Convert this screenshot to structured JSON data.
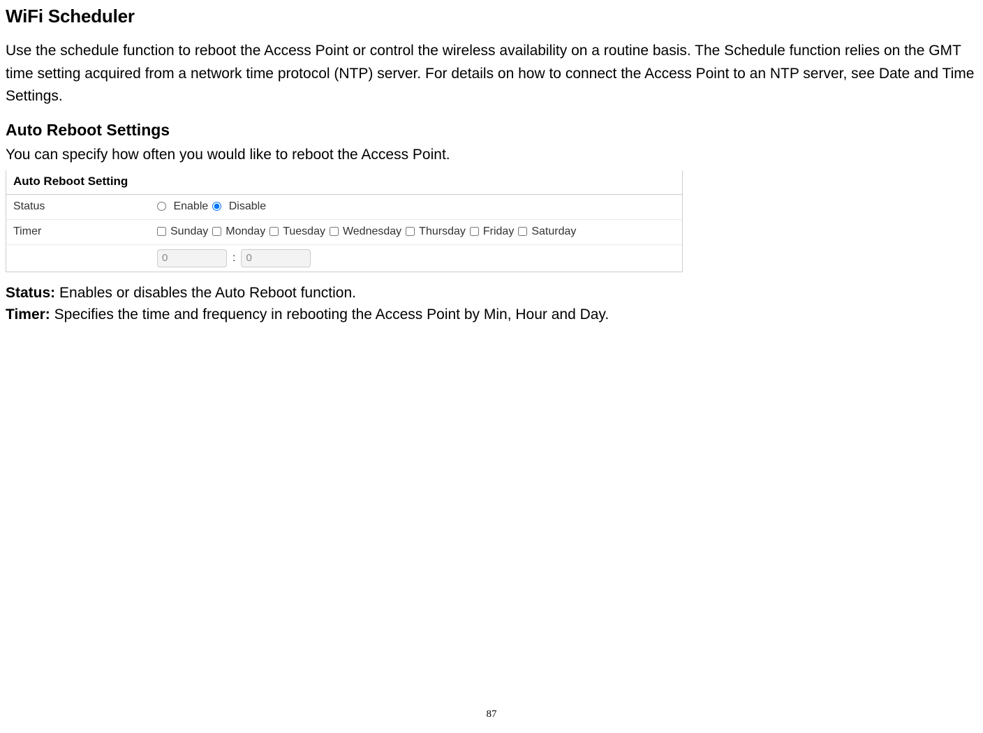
{
  "page": {
    "title": "WiFi Scheduler",
    "intro": "Use the schedule function to reboot the Access Point or control the wireless availability on a routine basis. The Schedule function relies on the GMT time setting acquired from a network time protocol (NTP) server. For details on how to connect the Access Point to an NTP server, see Date and Time Settings.",
    "section_title": "Auto Reboot Settings",
    "section_desc": "You can specify how often you would like to reboot the Access Point.",
    "page_number": "87"
  },
  "panel": {
    "heading": "Auto Reboot Setting",
    "status_label": "Status",
    "status_enable": "Enable",
    "status_disable": "Disable",
    "timer_label": "Timer",
    "days": [
      "Sunday",
      "Monday",
      "Tuesday",
      "Wednesday",
      "Thursday",
      "Friday",
      "Saturday"
    ],
    "hour_value": "0",
    "minute_value": "0"
  },
  "definitions": {
    "status_term": "Status:",
    "status_def": "Enables or disables the Auto Reboot function.",
    "timer_term": "Timer:",
    "timer_def": "Specifies the time and frequency in rebooting the Access Point by Min, Hour and Day."
  }
}
